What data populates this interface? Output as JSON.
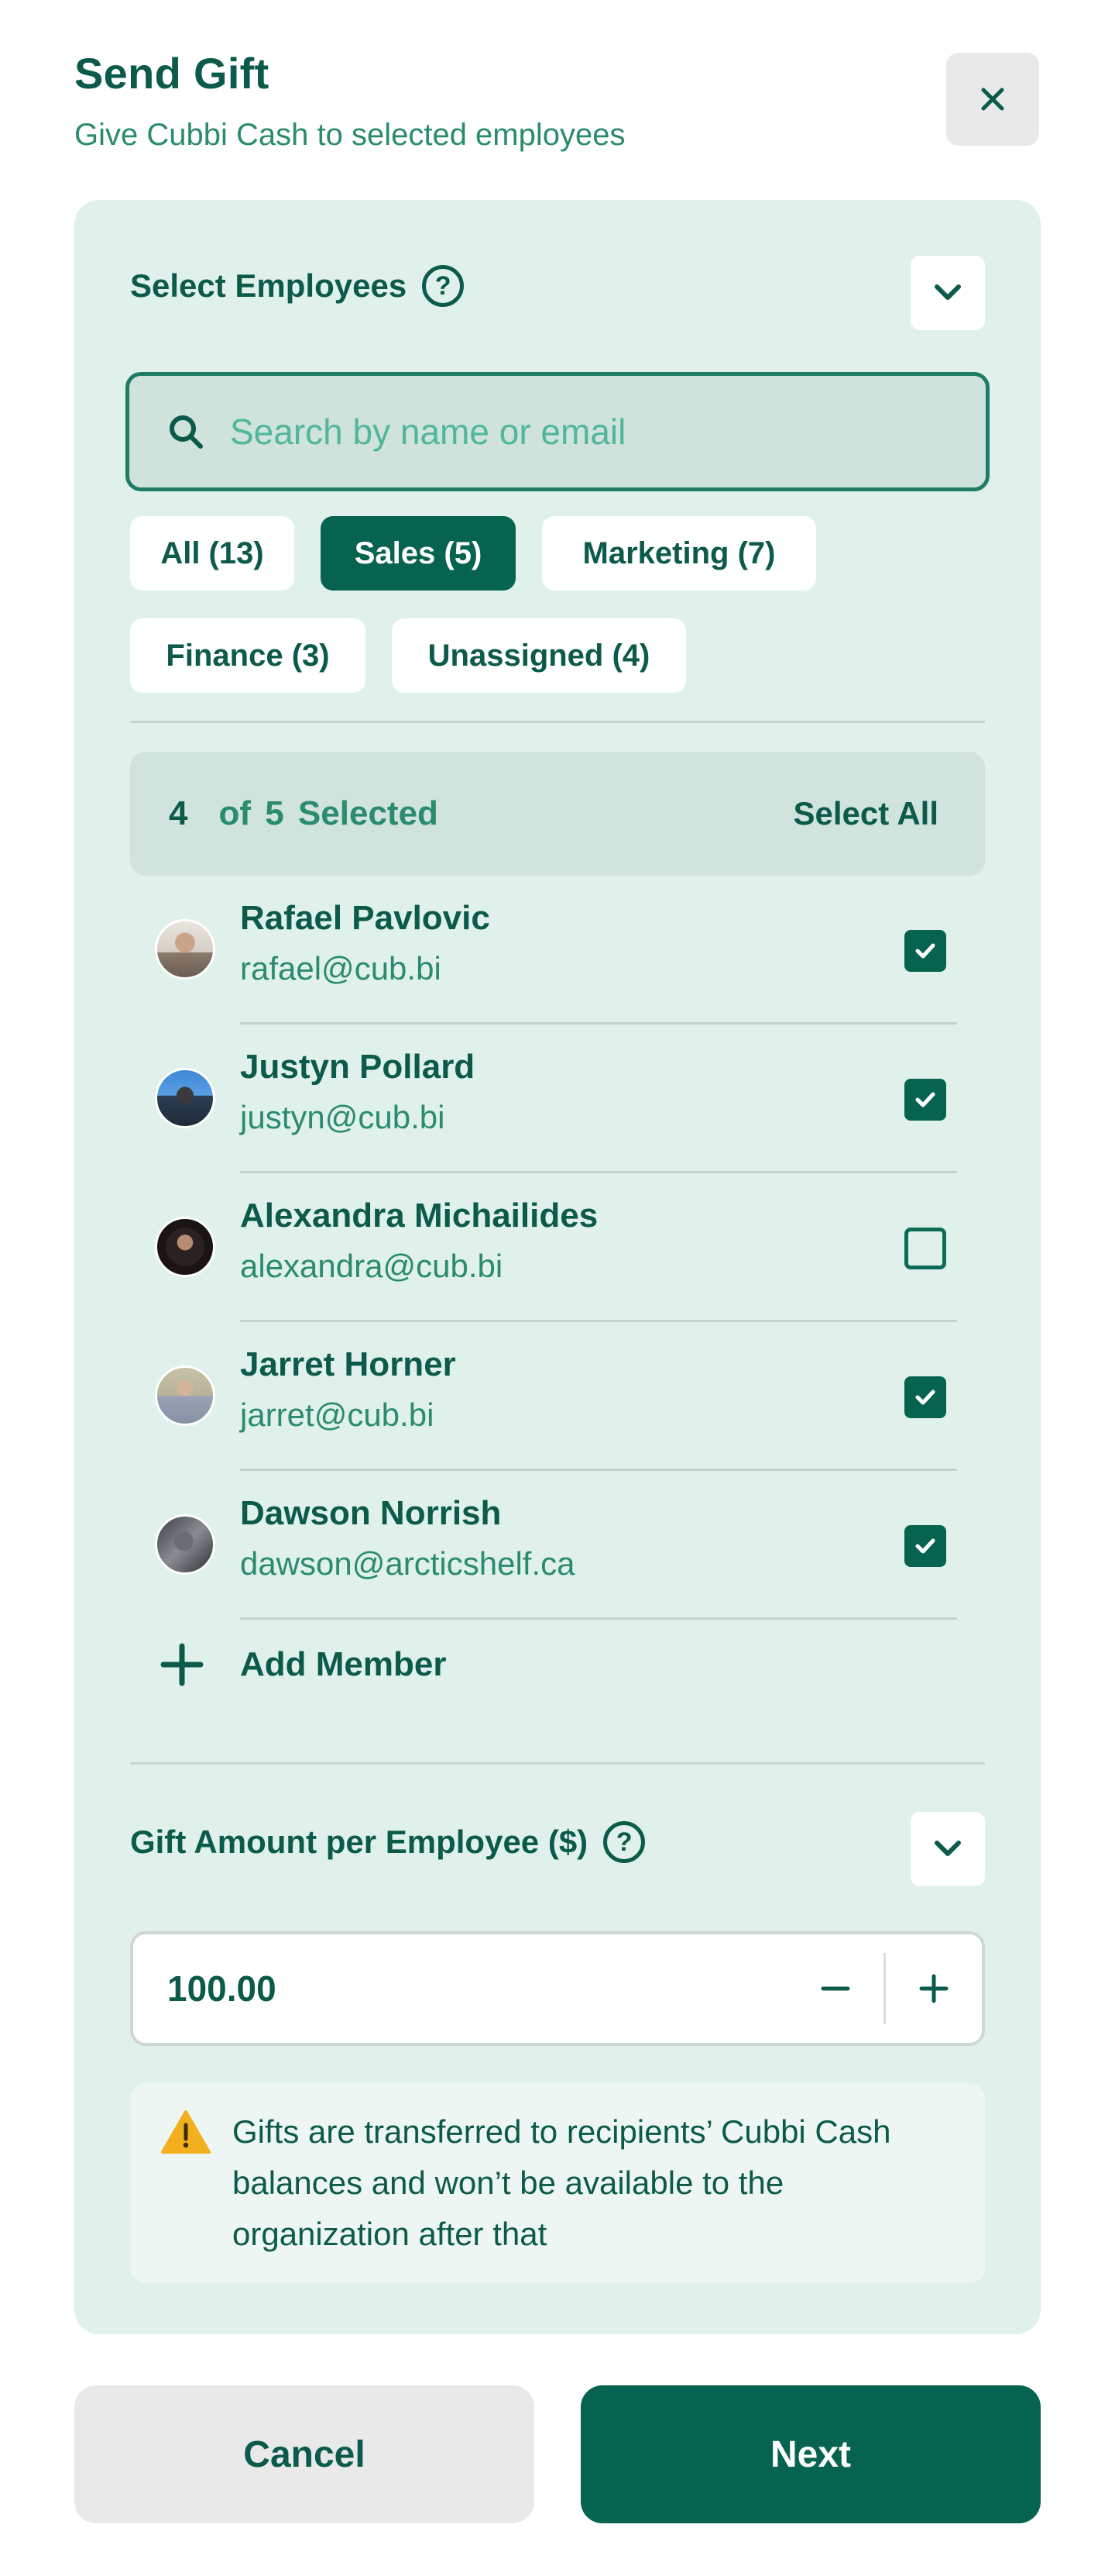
{
  "header": {
    "title": "Send Gift",
    "subtitle": "Give Cubbi Cash to selected employees"
  },
  "employees_section": {
    "title": "Select Employees",
    "help_symbol": "?"
  },
  "search": {
    "placeholder": "Search by name or email",
    "value": ""
  },
  "filters": [
    {
      "label": "All (13)",
      "active": false
    },
    {
      "label": "Sales (5)",
      "active": true
    },
    {
      "label": "Marketing (7)",
      "active": false
    },
    {
      "label": "Finance (3)",
      "active": false
    },
    {
      "label": "Unassigned (4)",
      "active": false
    }
  ],
  "selection": {
    "selected": "4",
    "text": "of  5  Selected",
    "select_all_label": "Select All"
  },
  "employees": [
    {
      "name": "Rafael Pavlovic",
      "email": "rafael@cub.bi",
      "checked": true
    },
    {
      "name": "Justyn Pollard",
      "email": "justyn@cub.bi",
      "checked": true
    },
    {
      "name": "Alexandra Michailides",
      "email": "alexandra@cub.bi",
      "checked": false
    },
    {
      "name": "Jarret Horner",
      "email": "jarret@cub.bi",
      "checked": true
    },
    {
      "name": "Dawson Norrish",
      "email": "dawson@arcticshelf.ca",
      "checked": true
    }
  ],
  "add_member_label": "Add Member",
  "amount_section": {
    "title": "Gift Amount per Employee ($)",
    "help_symbol": "?",
    "value": "100.00",
    "decrement_symbol": "−",
    "increment_symbol": "+"
  },
  "notice": {
    "text": "Gifts are transferred to recipients’ Cubbi Cash balances and won’t be available to the organization after that",
    "icon": "warning-icon"
  },
  "actions": {
    "cancel_label": "Cancel",
    "next_label": "Next"
  },
  "colors": {
    "brand": "#05634f",
    "panel": "#e0f1ec",
    "accent_text": "#2a8b6f",
    "warning": "#f2b01e"
  }
}
